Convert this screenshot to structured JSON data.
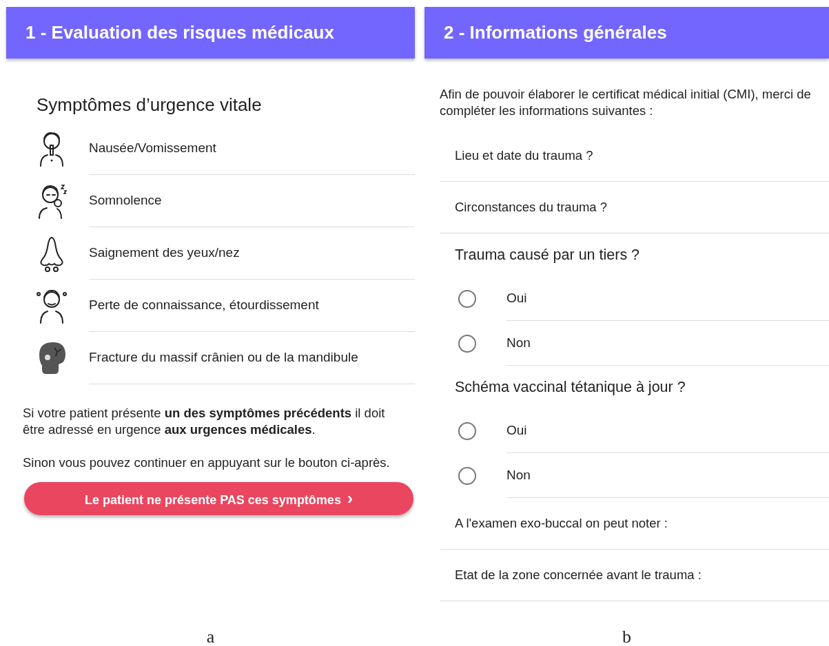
{
  "panels": [
    {
      "caption": "a",
      "title": "1 - Evaluation des risques médicaux",
      "heading": "Symptômes d’urgence vitale",
      "symptoms": [
        {
          "kind": "vomit",
          "label": "Nausée/Vomissement"
        },
        {
          "kind": "sleep",
          "label": "Somnolence"
        },
        {
          "kind": "nose",
          "label": "Saignement des yeux/nez"
        },
        {
          "kind": "dizzy",
          "label": "Perte de connaissance, étourdissement"
        },
        {
          "kind": "skull",
          "label": "Fracture du massif crânien ou de la mandibule"
        }
      ],
      "paragraphs": [
        "Si votre patient présente **un des symptômes précédents** il doit être adressé en urgence **aux urgences médicales**.",
        "Sinon vous pouvez continuer en appuyant sur le bouton ci-après."
      ],
      "button": {
        "label": "Le patient ne présente PAS ces symptômes",
        "icon": "›"
      }
    },
    {
      "caption": "b",
      "title": "2 - Informations générales",
      "intro": "Afin de pouvoir élaborer le certificat médical initial (CMI), merci de compléter les informations suivantes :",
      "fields": [
        {
          "kind": "field",
          "label": "Lieu et date du trauma ?"
        },
        {
          "kind": "field",
          "label": "Circonstances du trauma ?"
        },
        {
          "kind": "question",
          "label": "Trauma causé par un tiers ?",
          "options": [
            {
              "label": "Oui",
              "selected": false
            },
            {
              "label": "Non",
              "selected": false
            }
          ]
        },
        {
          "kind": "question",
          "label": "Schéma vaccinal tétanique à jour ?",
          "options": [
            {
              "label": "Oui",
              "selected": false
            },
            {
              "label": "Non",
              "selected": false
            }
          ]
        },
        {
          "kind": "field",
          "label": "A l'examen exo-buccal on peut noter :"
        },
        {
          "kind": "field",
          "label": "Etat de la zone concernée avant le trauma :"
        }
      ]
    }
  ]
}
